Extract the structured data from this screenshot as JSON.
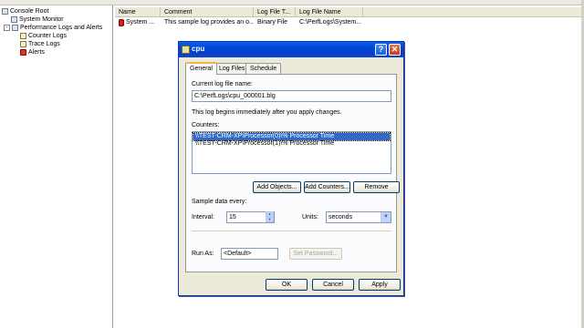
{
  "tree": {
    "items": [
      {
        "label": "Console Root"
      },
      {
        "label": "System Monitor"
      },
      {
        "label": "Performance Logs and Alerts",
        "expander": "-"
      },
      {
        "label": "Counter Logs"
      },
      {
        "label": "Trace Logs"
      },
      {
        "label": "Alerts"
      }
    ]
  },
  "list": {
    "columns": [
      "Name",
      "Comment",
      "Log File T...",
      "Log File Name"
    ],
    "rows": [
      {
        "name": "System ...",
        "comment": "This sample log provides an o...",
        "type": "Binary File",
        "file": "C:\\PerfLogs\\System..."
      }
    ]
  },
  "dialog": {
    "title": "cpu",
    "help_glyph": "?",
    "close_glyph": "✕",
    "tabs": [
      "General",
      "Log Files",
      "Schedule"
    ],
    "general": {
      "current_log_label": "Current log file name:",
      "current_log_value": "C:\\PerfLogs\\cpu_000001.blg",
      "info_text": "This log begins immediately after you apply changes.",
      "counters_label": "Counters:",
      "counters": [
        "\\\\TEST-CRM-XP\\Processor(0)\\% Processor Time",
        "\\\\TEST-CRM-XP\\Processor(1)\\% Processor Time"
      ],
      "add_objects": "Add Objects...",
      "add_counters": "Add Counters...",
      "remove": "Remove",
      "sample_label": "Sample data every:",
      "interval_label": "Interval:",
      "interval_value": "15",
      "units_label": "Units:",
      "units_value": "seconds",
      "run_as_label": "Run As:",
      "run_as_value": "<Default>",
      "set_password": "Set Password..."
    },
    "ok": "OK",
    "cancel": "Cancel",
    "apply": "Apply"
  }
}
